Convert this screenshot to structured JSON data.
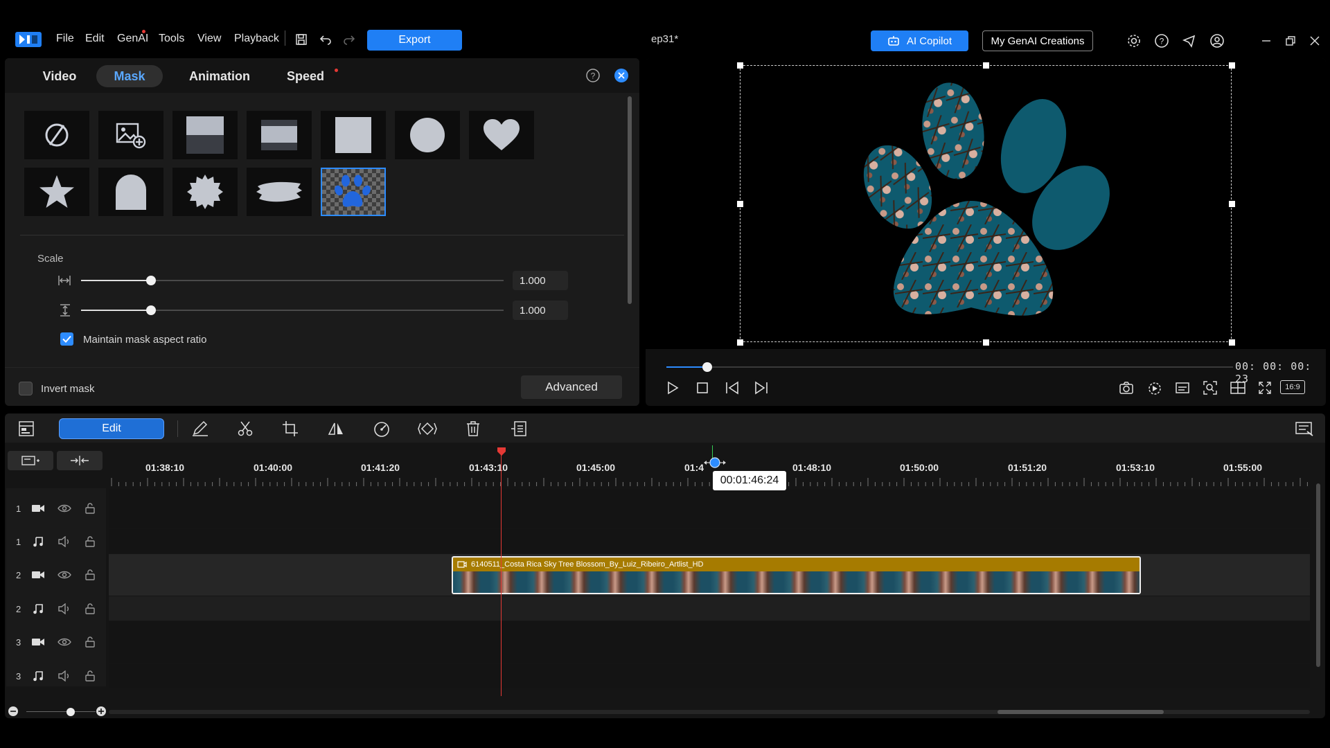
{
  "app": {
    "menu": [
      "File",
      "Edit",
      "GenAI",
      "Tools",
      "View",
      "Playback"
    ],
    "project_title": "ep31*",
    "export_label": "Export",
    "copilot_label": "AI Copilot",
    "mygenai_label": "My GenAI Creations"
  },
  "left_panel": {
    "tabs": [
      "Video",
      "Mask",
      "Animation",
      "Speed"
    ],
    "active_tab": "Mask",
    "mask_shapes": [
      "none",
      "image-mask",
      "gradient-top",
      "gradient-band",
      "square",
      "circle",
      "heart",
      "star",
      "arch",
      "starburst",
      "brush-stroke",
      "paw-print"
    ],
    "selected_mask": "paw-print",
    "scale_title": "Scale",
    "scale_width_value": "1.000",
    "scale_height_value": "1.000",
    "scale_width_level": 0.165,
    "scale_height_level": 0.165,
    "maintain_ratio_label": "Maintain mask aspect ratio",
    "maintain_ratio_checked": true,
    "invert_label": "Invert mask",
    "invert_checked": false,
    "advanced_label": "Advanced"
  },
  "preview": {
    "timecode": "00: 00: 00: 23",
    "progress": 0.072,
    "aspect_ratio": "16:9"
  },
  "timeline": {
    "edit_label": "Edit",
    "ruler_labels": [
      "01:38:10",
      "01:40:00",
      "01:41:20",
      "01:43:10",
      "01:45:00",
      "01:4",
      "01:48:10",
      "01:50:00",
      "01:51:20",
      "01:53:10",
      "01:55:00"
    ],
    "hover_timecode": "00:01:46:24",
    "tracks": [
      {
        "num": "1",
        "type": "video"
      },
      {
        "num": "1",
        "type": "audio"
      },
      {
        "num": "2",
        "type": "video"
      },
      {
        "num": "2",
        "type": "audio"
      },
      {
        "num": "3",
        "type": "video"
      },
      {
        "num": "3",
        "type": "audio"
      }
    ],
    "clip_name": "6140511_Costa Rica Sky Tree Blossom_By_Luiz_Ribeiro_Artlist_HD"
  },
  "colors": {
    "accent": "#1f7ff5",
    "mask_fill": "#0e5a6e",
    "clip_header": "#a67b00",
    "playhead": "#e53935"
  }
}
